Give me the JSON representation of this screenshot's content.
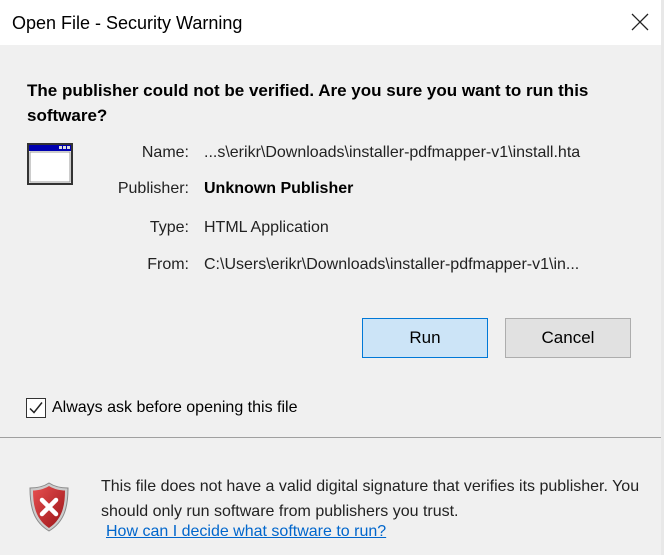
{
  "window": {
    "title": "Open File - Security Warning",
    "close_icon": "close-icon"
  },
  "heading": "The publisher could not be verified.  Are you sure you want to run this software?",
  "fields": [
    {
      "label": "Name:",
      "value": "...s\\erikr\\Downloads\\installer-pdfmapper-v1\\install.hta",
      "bold": false
    },
    {
      "label": "Publisher:",
      "value": "Unknown Publisher",
      "bold": true
    },
    {
      "label": "Type:",
      "value": "HTML Application",
      "bold": false
    },
    {
      "label": "From:",
      "value": "C:\\Users\\erikr\\Downloads\\installer-pdfmapper-v1\\in...",
      "bold": false
    }
  ],
  "buttons": {
    "run": "Run",
    "cancel": "Cancel"
  },
  "checkbox": {
    "label": "Always ask before opening this file",
    "checked": true
  },
  "footer": {
    "message": "This file does not have a valid digital signature that verifies its publisher.  You should only run software from publishers you trust.",
    "link": "How can I decide what software to run?",
    "icon": "shield-error-icon"
  },
  "colors": {
    "accent": "#0078d7",
    "link": "#0066cc",
    "shield": "#c0282d"
  }
}
